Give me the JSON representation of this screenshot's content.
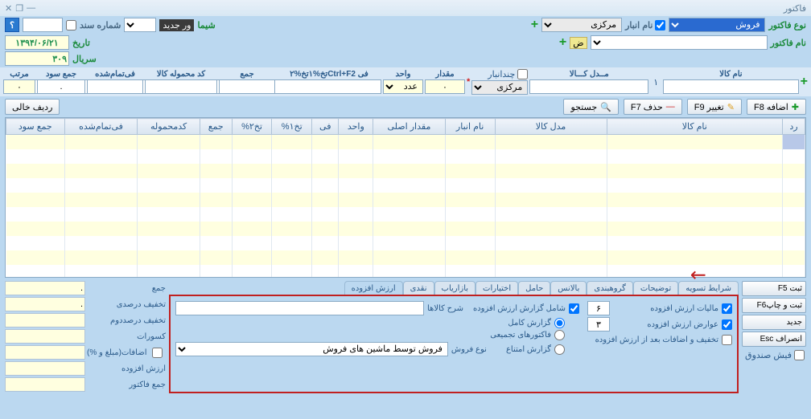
{
  "window": {
    "title": "فاکتور",
    "minimize": "—",
    "restore": "❐",
    "close": "✕"
  },
  "top": {
    "invoice_type_lbl": "نوع فاکتور",
    "invoice_type_val": "فروش",
    "warehouse_name_lbl": "نام انبار",
    "warehouse_val": "مرکزی",
    "shima": "شیما",
    "vor_jadid": "ور جدید",
    "doc_no_lbl": "شماره سند",
    "invoice_name_lbl": "نام فاکتور",
    "currency_badge": "ض",
    "date_lbl": "تاریخ",
    "date_val": "۱۳۹۴/۰۶/۲۱",
    "serial_lbl": "سریال",
    "serial_val": "۳۰۹"
  },
  "fields": {
    "item_name": "نام کالا",
    "item_model": "مــدل کـــالا",
    "multi_wh": "چندانبار",
    "wh_val": "مرکزی",
    "qty": "مقدار",
    "unit": "واحد",
    "fee": "فی  Ctrl+F2تخ%۱تخ%۲",
    "sum": "جمع",
    "package_code": "کد محموله کالا",
    "fee_done": "فی‌تمام‌شده",
    "profit_sum": "جمع سود",
    "sort": "مرتب",
    "qty_val": "۰",
    "unit_val": "عدد",
    "dot_val": ".",
    "row_num": "۱"
  },
  "buttons": {
    "add": "اضافه  F8",
    "edit": "تغییر  F9",
    "delete": "حذف  F7",
    "search": "جستجو",
    "empty_row": "ردیف خالی"
  },
  "grid_headers": [
    "رد",
    "نام کالا",
    "مدل کالا",
    "نام انبار",
    "مقدار اصلی",
    "واحد",
    "فی",
    "تخ۱%",
    "تخ۲%",
    "جمع",
    "کدمحموله",
    "فی‌تمام‌شده",
    "جمع سود"
  ],
  "left_buttons": {
    "save": "ثبت   F5",
    "save_print": "ثبت و چاپF6",
    "new": "جدید",
    "cancel": "انصراف Esc",
    "cash_receipt": "فیش صندوق"
  },
  "tabs": [
    "شرایط تسویه",
    "توضیحات",
    "گروهبندی",
    "بالانس",
    "حامل",
    "اختیارات",
    "بازاریاب",
    "نقدی",
    "ارزش افزوده"
  ],
  "vat": {
    "tax_lbl": "مالیات ارزش افزوده",
    "tax_val": "۶",
    "duty_lbl": "عوارض ارزش افزوده",
    "duty_val": "۳",
    "after_discount": "تخفیف و اضافات بعد از ارزش افزوده",
    "include_report": "شامل گزارش ارزش افزوده",
    "items_desc": "شرح کالاها",
    "full_report": "گزارش کامل",
    "agg_invoices": "فاکتورهای تجمیعی",
    "refuse_report": "گزارش امتناع",
    "sale_type_lbl": "نوع فروش",
    "sale_type_val": "فروش توسط ماشین های فروش"
  },
  "summary": {
    "sum": "جمع",
    "discount_pct": "تخفیف درصدی",
    "discount_pct2": "تخفیف درصددوم",
    "deductions": "کسورات",
    "additions": "اضافات(مبلغ و %)",
    "vat": "ارزش افزوده",
    "invoice_total": "جمع فاکتور"
  }
}
